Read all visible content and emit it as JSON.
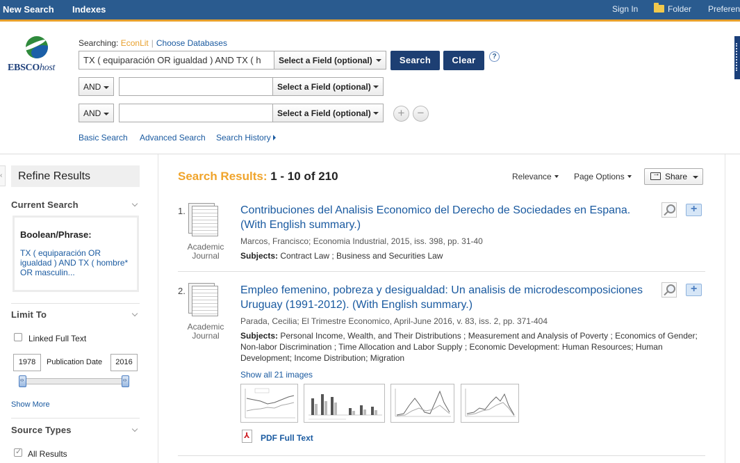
{
  "topnav": {
    "new_search": "New Search",
    "indexes": "Indexes",
    "sign_in": "Sign In",
    "folder": "Folder",
    "preferences": "Preferen"
  },
  "logo": {
    "brand": "EBSCO",
    "brand_suffix": "host"
  },
  "search": {
    "searching_label": "Searching:",
    "database": "EconLit",
    "choose_databases": "Choose Databases",
    "rows": [
      {
        "bool": "",
        "value": "TX ( equiparación OR igualdad ) AND TX ( h",
        "field": "Select a Field (optional)"
      },
      {
        "bool": "AND",
        "value": "",
        "field": "Select a Field (optional)"
      },
      {
        "bool": "AND",
        "value": "",
        "field": "Select a Field (optional)"
      }
    ],
    "search_button": "Search",
    "clear_button": "Clear",
    "help": "?",
    "add_row": "+",
    "remove_row": "−",
    "links": {
      "basic": "Basic Search",
      "advanced": "Advanced Search",
      "history": "Search History"
    }
  },
  "sidebar": {
    "collapse": "‹",
    "refine_title": "Refine Results",
    "current_search": {
      "heading": "Current Search",
      "boolean_label": "Boolean/Phrase:",
      "query": "TX ( equiparación OR igualdad ) AND TX ( hombre* OR masculin..."
    },
    "limit_to": {
      "heading": "Limit To",
      "linked_full_text": "Linked Full Text",
      "linked_full_text_checked": false,
      "date_from": "1978",
      "date_to": "2016",
      "date_label": "Publication Date",
      "show_more": "Show More"
    },
    "source_types": {
      "heading": "Source Types",
      "all_results": "All Results",
      "all_results_checked": true
    }
  },
  "results": {
    "label": "Search Results:",
    "range": "1 - 10 of 210",
    "relevance": "Relevance",
    "page_options": "Page Options",
    "share": "Share",
    "items": [
      {
        "num": "1.",
        "type_line1": "Academic",
        "type_line2": "Journal",
        "title": "Contribuciones del Analisis Economico del Derecho de Sociedades en Espana. (With English summary.)",
        "meta": "Marcos, Francisco; Economia Industrial, 2015, iss. 398, pp. 31-40",
        "subjects_label": "Subjects:",
        "subjects": "Contract Law ; Business and Securities Law"
      },
      {
        "num": "2.",
        "type_line1": "Academic",
        "type_line2": "Journal",
        "title": "Empleo femenino, pobreza y desigualdad: Un analisis de microdescomposiciones Uruguay (1991-2012). (With English summary.)",
        "meta": "Parada, Cecilia; El Trimestre Economico, April-June 2016, v. 83, iss. 2, pp. 371-404",
        "subjects_label": "Subjects:",
        "subjects": "Personal Income, Wealth, and Their Distributions ; Measurement and Analysis of Poverty ; Economics of Gender; Non-labor Discrimination ; Time Allocation and Labor Supply ; Economic Development: Human Resources; Human Development; Income Distribution; Migration",
        "show_images": "Show all 21 images",
        "pdf": "PDF Full Text"
      }
    ]
  },
  "colors": {
    "topbar": "#2a5b8f",
    "accent_orange": "#e8a02c",
    "button_navy": "#1d3f73",
    "link_blue": "#1a5aa0"
  }
}
